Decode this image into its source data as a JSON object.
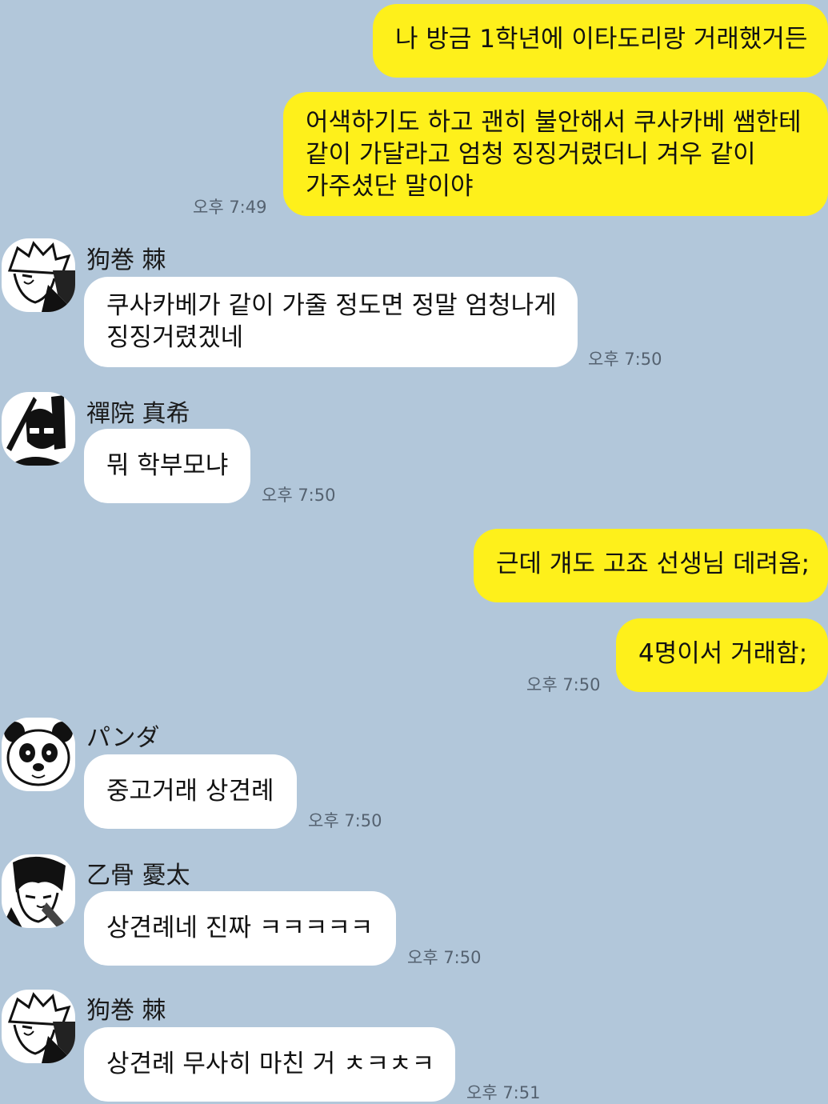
{
  "messages": [
    {
      "sender": "me",
      "text": "나 방금 1학년에 이타도리랑 거래했거든",
      "time": ""
    },
    {
      "sender": "me",
      "lines": [
        "어색하기도 하고 괜히 불안해서 쿠사카베 쌤한테",
        "같이 가달라고 엄청 징징거렸더니 겨우 같이",
        "가주셨단 말이야"
      ],
      "time": "오후 7:49"
    },
    {
      "sender": "狗巻 棘",
      "lines": [
        "쿠사카베가 같이 가줄 정도면 정말 엄청나게",
        "징징거렸겠네"
      ],
      "time": "오후 7:50"
    },
    {
      "sender": "禪院 真希",
      "text": "뭐 학부모냐",
      "time": "오후 7:50"
    },
    {
      "sender": "me",
      "text": "근데 걔도 고죠 선생님 데려옴;",
      "time": ""
    },
    {
      "sender": "me",
      "text": "4명이서 거래함;",
      "time": "오후 7:50"
    },
    {
      "sender": "パンダ",
      "text": "중고거래 상견례",
      "time": "오후 7:50"
    },
    {
      "sender": "乙骨 憂太",
      "text": "상견례네 진짜 ㅋㅋㅋㅋㅋ",
      "time": "오후 7:50"
    },
    {
      "sender": "狗巻 棘",
      "text": "상견례 무사히 마친 거 ㅊㅋㅊㅋ",
      "time": "오후 7:51"
    }
  ],
  "avatars": {
    "toge": "toge-avatar-icon",
    "maki": "maki-avatar-icon",
    "panda": "panda-avatar-icon",
    "yuta": "yuta-avatar-icon"
  },
  "colors": {
    "background": "#b2c7da",
    "my_bubble": "#fef01b",
    "their_bubble": "#ffffff"
  }
}
